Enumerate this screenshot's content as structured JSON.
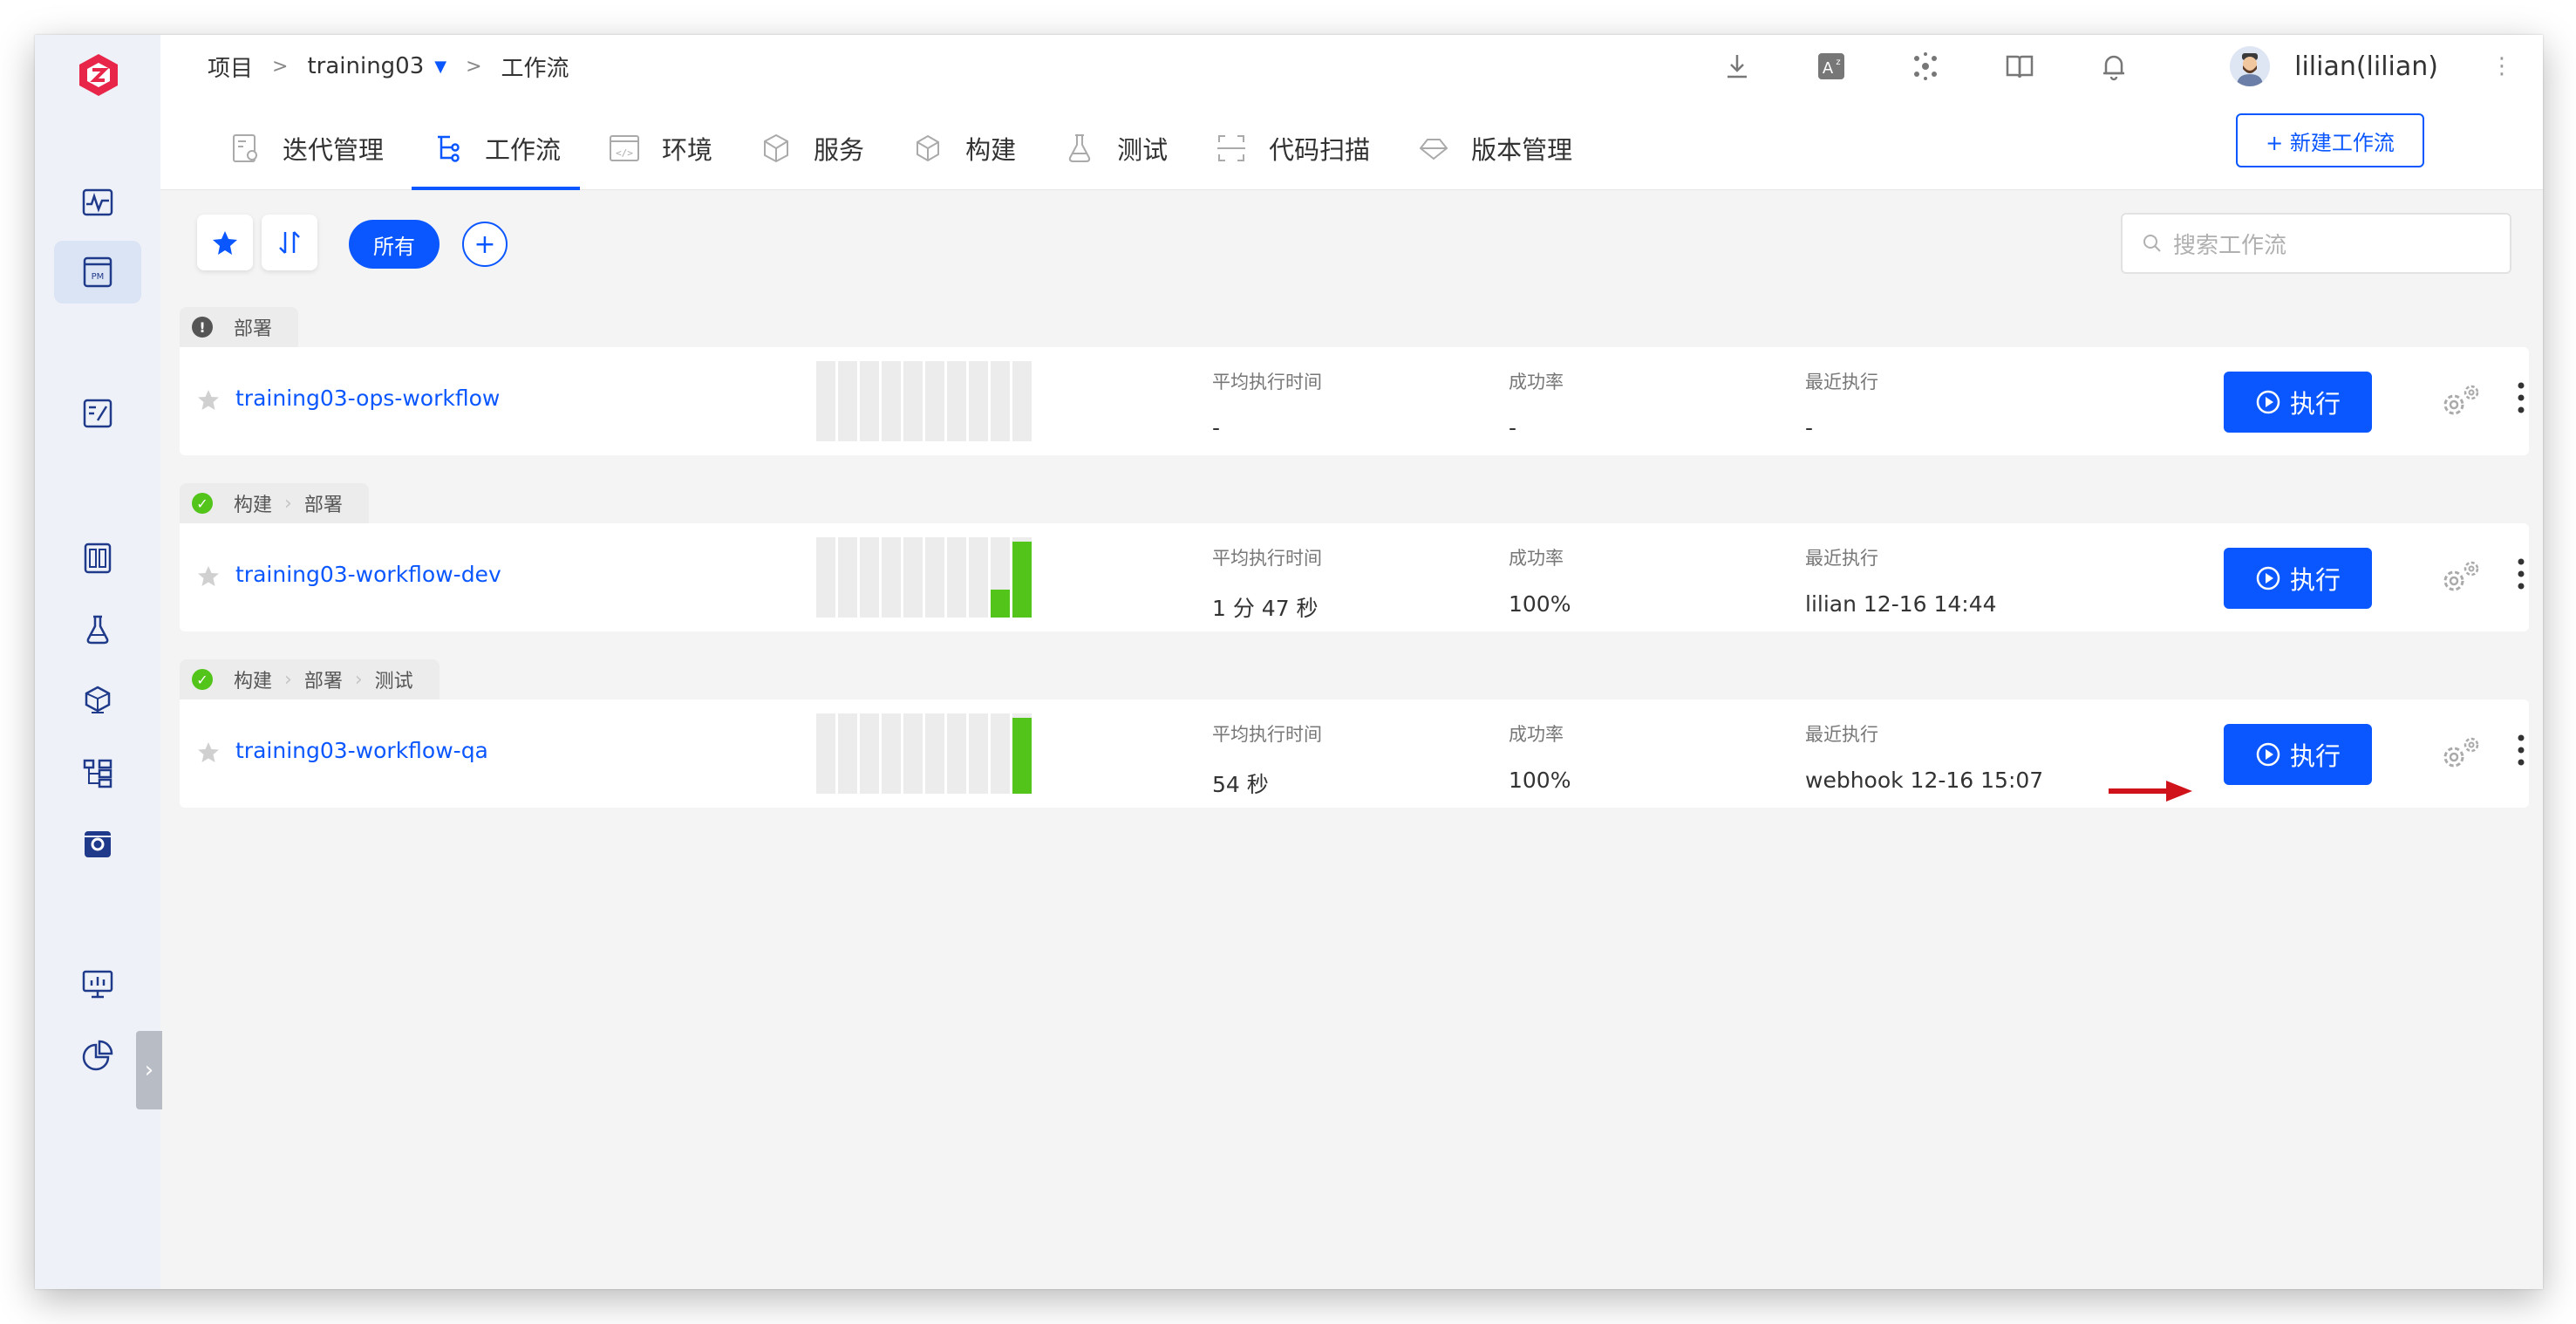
{
  "breadcrumb": {
    "project_label": "项目",
    "sep1": ">",
    "project_name": "training03",
    "sep2": ">",
    "current": "工作流"
  },
  "user": {
    "name": "lilian(lilian)"
  },
  "tabs": [
    {
      "label": "迭代管理",
      "icon": "iteration-icon",
      "active": false
    },
    {
      "label": "工作流",
      "icon": "workflow-icon",
      "active": true
    },
    {
      "label": "环境",
      "icon": "environment-icon",
      "active": false
    },
    {
      "label": "服务",
      "icon": "service-icon",
      "active": false
    },
    {
      "label": "构建",
      "icon": "build-icon",
      "active": false
    },
    {
      "label": "测试",
      "icon": "test-flask-icon",
      "active": false
    },
    {
      "label": "代码扫描",
      "icon": "code-scan-icon",
      "active": false
    },
    {
      "label": "版本管理",
      "icon": "version-icon",
      "active": false
    }
  ],
  "new_workflow_button": "+ 新建工作流",
  "toolbar": {
    "filter_all": "所有",
    "add_filter": "+",
    "search_placeholder": "搜索工作流"
  },
  "metric_labels": {
    "avg_time": "平均执行时间",
    "success_rate": "成功率",
    "last_run": "最近执行"
  },
  "run_button_label": "执行",
  "workflows": [
    {
      "stages": [
        "部署"
      ],
      "status": "warning",
      "name": "training03-ops-workflow",
      "avg_time": "-",
      "success_rate": "-",
      "last_run": "-",
      "history_bars": [
        0,
        0,
        0,
        0,
        0,
        0,
        0,
        0,
        0,
        0
      ]
    },
    {
      "stages": [
        "构建",
        "部署"
      ],
      "status": "success",
      "name": "training03-workflow-dev",
      "avg_time": "1 分 47 秒",
      "success_rate": "100%",
      "last_run": "lilian 12-16 14:44",
      "history_bars": [
        0,
        0,
        0,
        0,
        0,
        0,
        0,
        0,
        0.35,
        0.95
      ]
    },
    {
      "stages": [
        "构建",
        "部署",
        "测试"
      ],
      "status": "success",
      "name": "training03-workflow-qa",
      "avg_time": "54 秒",
      "success_rate": "100%",
      "last_run": "webhook 12-16 15:07",
      "history_bars": [
        0,
        0,
        0,
        0,
        0,
        0,
        0,
        0,
        0,
        0.95
      ]
    }
  ],
  "colors": {
    "primary": "#0b57ff",
    "success": "#52c41a",
    "warning_dark": "#555555",
    "annotation_arrow": "#d0121b",
    "logo": "#e8264a"
  }
}
